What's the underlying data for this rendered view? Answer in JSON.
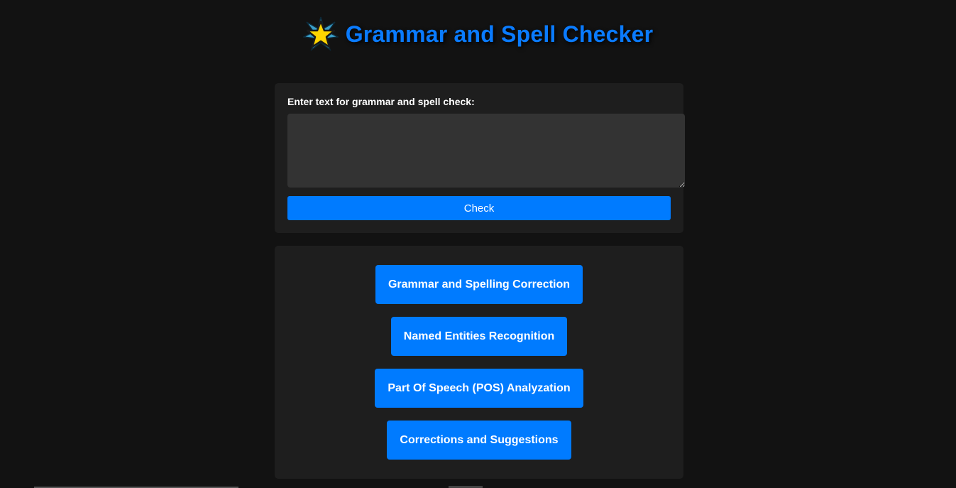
{
  "header": {
    "icon": "star-icon",
    "title": "Grammar and Spell Checker"
  },
  "input_card": {
    "label": "Enter text for grammar and spell check:",
    "textarea_value": "",
    "check_label": "Check"
  },
  "options": [
    {
      "label": "Grammar and Spelling Correction"
    },
    {
      "label": "Named Entities Recognition"
    },
    {
      "label": "Part Of Speech (POS) Analyzation"
    },
    {
      "label": "Corrections and Suggestions"
    }
  ],
  "colors": {
    "background": "#121212",
    "card": "#1e1e1e",
    "accent": "#007bff",
    "title": "#0a7bff",
    "textarea": "#333333"
  }
}
